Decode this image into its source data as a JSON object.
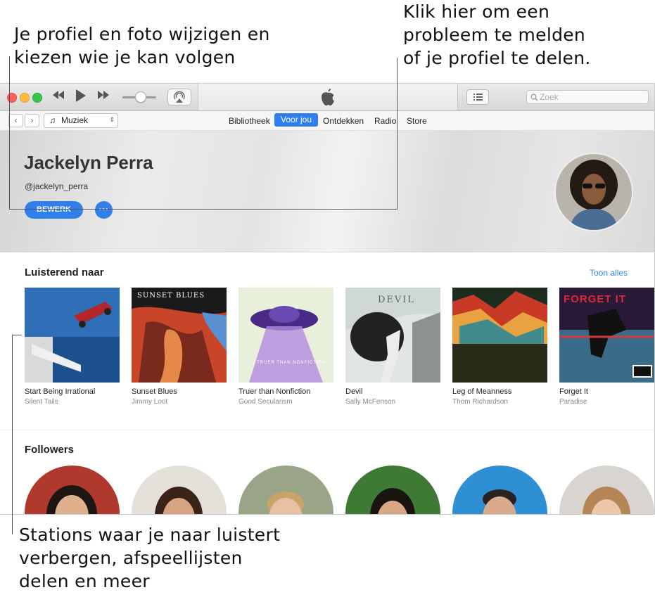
{
  "callouts": {
    "top_left": [
      "Je profiel en foto wijzigen en",
      "kiezen wie je kan volgen"
    ],
    "top_right": [
      "Klik hier om een",
      "probleem te melden",
      "of je profiel te delen."
    ],
    "bottom_left": [
      "Stations waar je naar luistert",
      "verbergen, afspeellijsten",
      "delen en meer"
    ]
  },
  "toolbar": {
    "search_placeholder": "Zoek"
  },
  "navbar": {
    "source_label": "Muziek",
    "tabs": [
      "Bibliotheek",
      "Voor jou",
      "Ontdekken",
      "Radio",
      "Store"
    ],
    "active_tab": "Voor jou"
  },
  "profile": {
    "name": "Jackelyn Perra",
    "handle": "@jackelyn_perra",
    "edit_label": "BEWERK",
    "more_label": "···"
  },
  "listening": {
    "title": "Luisterend naar",
    "show_all": "Toon alles",
    "albums": [
      {
        "title": "Start Being Irrational",
        "artist": "Silent Tails",
        "cover_text": ""
      },
      {
        "title": "Sunset Blues",
        "artist": "Jimmy Loot",
        "cover_text": "SUNSET BLUES"
      },
      {
        "title": "Truer than Nonfiction",
        "artist": "Good Secularism",
        "cover_text": "TRUER THAN NONFICTION"
      },
      {
        "title": "Devil",
        "artist": "Sally McFenson",
        "cover_text": "DEVIL"
      },
      {
        "title": "Leg of Meanness",
        "artist": "Thom Richardson",
        "cover_text": ""
      },
      {
        "title": "Forget It",
        "artist": "Paradise",
        "cover_text": "FORGET IT"
      }
    ]
  },
  "followers": {
    "title": "Followers"
  },
  "colors": {
    "accent": "#2f80ed",
    "close": "#fc605c",
    "minimize": "#fdbc40",
    "zoom": "#34c84a"
  }
}
